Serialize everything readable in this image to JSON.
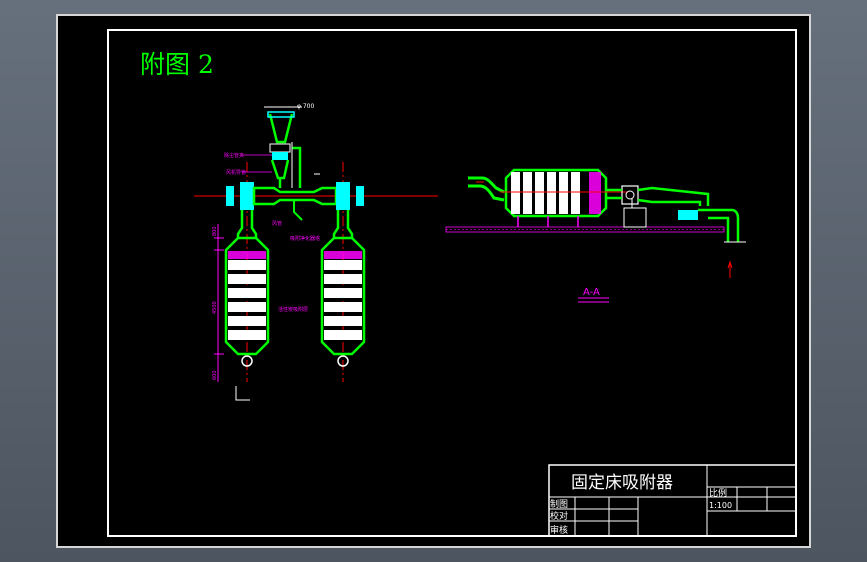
{
  "sheet": {
    "figure_label": "附图 2",
    "section_label": "A-A",
    "dimension_top": "φ 700"
  },
  "left_view": {
    "annotations": [
      "除尘管夹",
      "风机导管",
      "风管",
      "吸附净化器塔",
      "活性炭吸附层"
    ],
    "dims": [
      "800",
      "4500",
      "600"
    ]
  },
  "title_block": {
    "drawing_title": "固定床吸附器",
    "scale_label": "比例",
    "scale_value": "1:100",
    "rows": [
      "制图",
      "校对",
      "审核"
    ]
  },
  "colors": {
    "background": "#000000",
    "border": "#ffffff",
    "label": "#00ff00",
    "pipe": "#00ff00",
    "vessel": "#ffffff",
    "dimension": "#ff00ff",
    "centerline": "#ff0000",
    "hatch": "#ff00ff",
    "fan": "#00ffff"
  }
}
